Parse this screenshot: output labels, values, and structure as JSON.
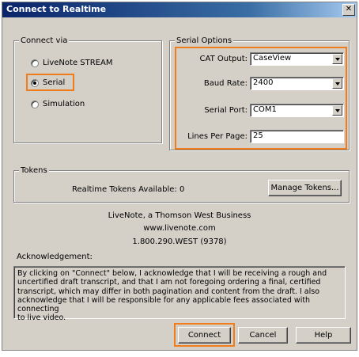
{
  "window": {
    "title": "Connect to Realtime"
  },
  "connect_via": {
    "legend": "Connect via",
    "options": [
      {
        "label": "LiveNote STREAM",
        "selected": false
      },
      {
        "label": "Serial",
        "selected": true
      },
      {
        "label": "Simulation",
        "selected": false
      }
    ]
  },
  "serial_options": {
    "legend": "Serial Options",
    "cat_output_label": "CAT Output:",
    "cat_output_value": "CaseView",
    "baud_rate_label": "Baud Rate:",
    "baud_rate_value": "2400",
    "serial_port_label": "Serial Port:",
    "serial_port_value": "COM1",
    "lines_per_page_label": "Lines Per Page:",
    "lines_per_page_value": "25"
  },
  "tokens": {
    "legend": "Tokens",
    "available_text": "Realtime Tokens Available:  0",
    "manage_label": "Manage Tokens..."
  },
  "company": {
    "name": "LiveNote, a Thomson West Business",
    "website": "www.livenote.com",
    "phone": "1.800.290.WEST (9378)"
  },
  "acknowledgement": {
    "label": "Acknowledgement:",
    "lines": [
      "By clicking on \"Connect\" below, I acknowledge that I will be receiving a rough and",
      "uncertified draft transcript, and that I am not foregoing ordering a final, certified",
      "transcript, which may differ in both pagination and content from the draft.  I also",
      "acknowledge that I will be responsible for any applicable fees associated with connecting",
      "to live video."
    ]
  },
  "buttons": {
    "connect": "Connect",
    "cancel": "Cancel",
    "help": "Help"
  },
  "colors": {
    "highlight": "#f07c1c",
    "titlebar": "#0a246a"
  }
}
